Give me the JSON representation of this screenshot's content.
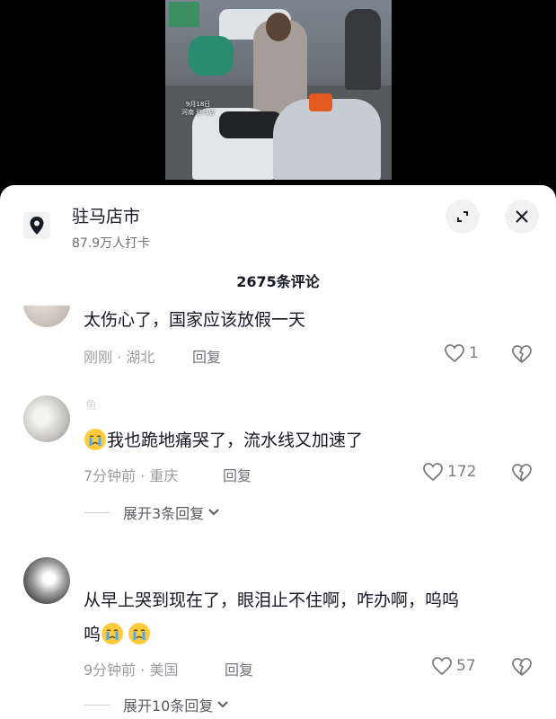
{
  "video": {
    "caption_line1": "9月18日",
    "caption_line2": "河南 驻马店"
  },
  "location": {
    "icon": "location-pin-icon",
    "title": "驻马店市",
    "subtitle": "87.9万人打卡"
  },
  "header_buttons": {
    "expand_icon": "expand-icon",
    "close_icon": "close-icon"
  },
  "comments_count": "2675条评论",
  "comments": [
    {
      "text": "太伤心了，国家应该放假一天",
      "time": "刚刚",
      "region": "湖北",
      "reply_label": "回复",
      "likes": "1"
    },
    {
      "username": "鱼",
      "text": "我也跪地痛哭了，流水线又加速了",
      "time": "7分钟前",
      "region": "重庆",
      "reply_label": "回复",
      "likes": "172",
      "expand_replies": "展开3条回复"
    },
    {
      "username": "",
      "text_line1": "从早上哭到现在了，眼泪止不住啊，咋办啊，呜呜",
      "text_line2": "呜",
      "time": "9分钟前",
      "region": "美国",
      "reply_label": "回复",
      "likes": "57",
      "expand_replies": "展开10条回复"
    }
  ],
  "colors": {
    "sheet_bg": "#ffffff",
    "text_primary": "#161823",
    "text_meta": "#9b9ca0"
  }
}
